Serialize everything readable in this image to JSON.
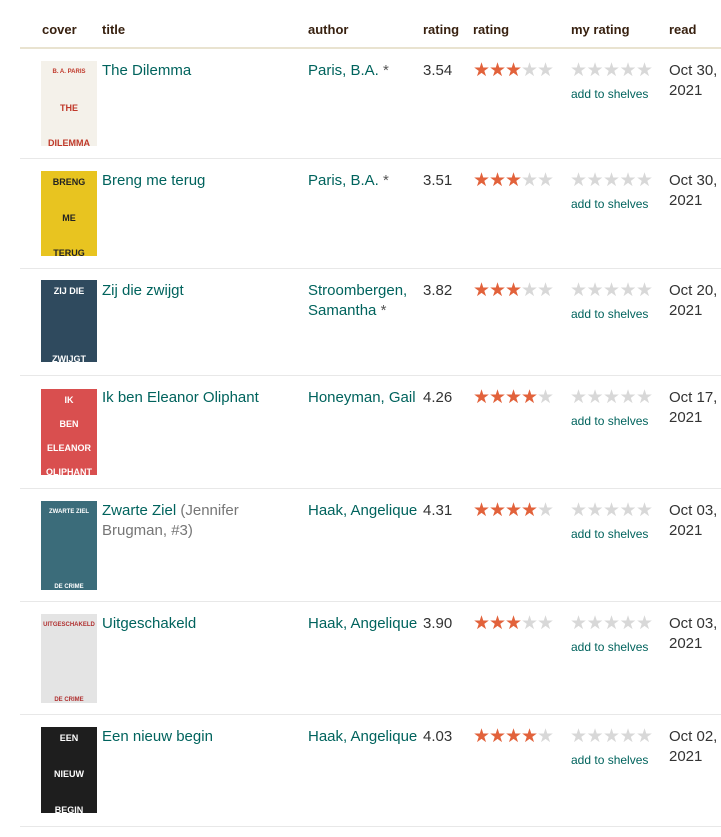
{
  "columns": {
    "cover": "cover",
    "title": "title",
    "author": "author",
    "avg_rating": "rating",
    "rating": "rating",
    "my_rating": "my rating",
    "read": "read"
  },
  "colors": {
    "link": "#00635d",
    "star_on": "#e2623b",
    "star_off": "#d8d8d8",
    "header_text": "#382110"
  },
  "star_icon": "star-icon",
  "books": [
    {
      "title": "The Dilemma",
      "series": "",
      "author": "Paris, B.A.",
      "author_note": "*",
      "avg_rating": "3.54",
      "stars": 3,
      "shelves_link": "add to shelves",
      "read_date": "Oct 30, 2021",
      "cover": {
        "bg": "#f4f1ea",
        "fg": "#c0392b",
        "lines": [
          "B. A. PARIS",
          "THE",
          "DILEMMA"
        ]
      }
    },
    {
      "title": "Breng me terug",
      "series": "",
      "author": "Paris, B.A.",
      "author_note": "*",
      "avg_rating": "3.51",
      "stars": 3,
      "shelves_link": "add to shelves",
      "read_date": "Oct 30, 2021",
      "cover": {
        "bg": "#e8c420",
        "fg": "#222222",
        "lines": [
          "BRENG",
          "ME",
          "TERUG"
        ]
      }
    },
    {
      "title": "Zij die zwijgt",
      "series": "",
      "author": "Stroombergen, Samantha",
      "author_note": "*",
      "avg_rating": "3.82",
      "stars": 3,
      "shelves_link": "add to shelves",
      "read_date": "Oct 20, 2021",
      "cover": {
        "bg": "#2f4a5e",
        "fg": "#ffffff",
        "lines": [
          "ZIJ DIE",
          "ZWIJGT"
        ]
      }
    },
    {
      "title": "Ik ben Eleanor Oliphant",
      "series": "",
      "author": "Honeyman, Gail",
      "author_note": "",
      "avg_rating": "4.26",
      "stars": 4,
      "shelves_link": "add to shelves",
      "read_date": "Oct 17, 2021",
      "cover": {
        "bg": "#d94f4f",
        "fg": "#ffffff",
        "lines": [
          "IK",
          "BEN",
          "ELEANOR",
          "OLIPHANT"
        ]
      }
    },
    {
      "title": "Zwarte Ziel",
      "series": "(Jennifer Brugman, #3)",
      "author": "Haak, Angelique",
      "author_note": "",
      "avg_rating": "4.31",
      "stars": 4,
      "shelves_link": "add to shelves",
      "read_date": "Oct 03, 2021",
      "cover": {
        "bg": "#3b6c7a",
        "fg": "#ffffff",
        "lines": [
          "ZWARTE ZIEL",
          "DE CRIME COMPAGNIE"
        ]
      }
    },
    {
      "title": "Uitgeschakeld",
      "series": "",
      "author": "Haak, Angelique",
      "author_note": "",
      "avg_rating": "3.90",
      "stars": 3,
      "shelves_link": "add to shelves",
      "read_date": "Oct 03, 2021",
      "cover": {
        "bg": "#e4e4e4",
        "fg": "#b03030",
        "lines": [
          "UITGESCHAKELD",
          "DE CRIME COMPAGNIE"
        ]
      }
    },
    {
      "title": "Een nieuw begin",
      "series": "",
      "author": "Haak, Angelique",
      "author_note": "",
      "avg_rating": "4.03",
      "stars": 4,
      "shelves_link": "add to shelves",
      "read_date": "Oct 02, 2021",
      "cover": {
        "bg": "#1e1e1e",
        "fg": "#ffffff",
        "lines": [
          "EEN",
          "NIEUW",
          "BEGIN"
        ]
      }
    }
  ]
}
